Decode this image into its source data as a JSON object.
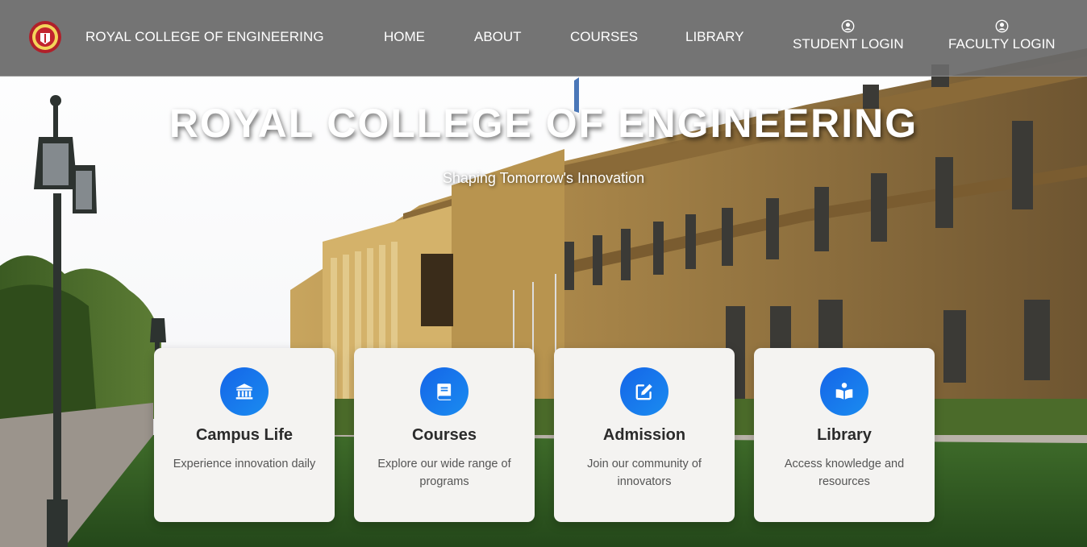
{
  "navbar": {
    "brand": "ROYAL COLLEGE OF ENGINEERING",
    "links": [
      "HOME",
      "ABOUT",
      "COURSES",
      "LIBRARY"
    ],
    "student_login": "STUDENT LOGIN",
    "faculty_login": "FACULTY LOGIN"
  },
  "hero": {
    "title": "ROYAL COLLEGE OF ENGINEERING",
    "subtitle": "Shaping Tomorrow's Innovation"
  },
  "cards": [
    {
      "title": "Campus Life",
      "text": "Experience innovation daily",
      "icon": "university-icon"
    },
    {
      "title": "Courses",
      "text": "Explore our wide range of programs",
      "icon": "book-icon"
    },
    {
      "title": "Admission",
      "text": "Join our community of innovators",
      "icon": "edit-icon"
    },
    {
      "title": "Library",
      "text": "Access knowledge and resources",
      "icon": "reader-icon"
    }
  ],
  "colors": {
    "navbar": "#696969",
    "icon_circle": "#1a7ff0",
    "card": "#f4f3f1"
  }
}
